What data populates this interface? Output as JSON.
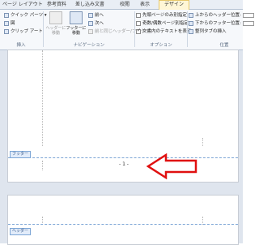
{
  "tabs": [
    "ページ レイアウト",
    "参考資料",
    "差し込み文書",
    "校閲",
    "表示",
    "デザイン"
  ],
  "ribbon": {
    "insert": {
      "quick_parts": "クイック パーツ",
      "picture": "図",
      "clip_art": "クリップ アート",
      "group_label": "挿入"
    },
    "navigation": {
      "goto_header": "ヘッダーに\n移動",
      "goto_footer": "フッターに\n移動",
      "previous": "前へ",
      "next": "次へ",
      "link_previous": "前と同じヘッダー/フッター",
      "group_label": "ナビゲーション"
    },
    "options": {
      "different_first_page": "先頭ページのみ別指定",
      "different_odd_even": "奇数/偶数ページ別指定",
      "show_document_text": "文書内のテキストを表示",
      "different_first_page_checked": false,
      "different_odd_even_checked": false,
      "show_document_text_checked": true,
      "group_label": "オプション"
    },
    "position": {
      "header_from_top": "上からのヘッダー位置:",
      "footer_from_bottom": "下からのフッター位置:",
      "insert_alignment_tab": "整列タブの挿入",
      "group_label": "位置"
    }
  },
  "document": {
    "footer_tag": "フッター",
    "header_tag": "ヘッダー",
    "page_number": "- 1 -"
  },
  "colors": {
    "arrow": "#e01010",
    "tab_active_bg": "#fff6d6",
    "guide_line": "#7da6d6"
  }
}
